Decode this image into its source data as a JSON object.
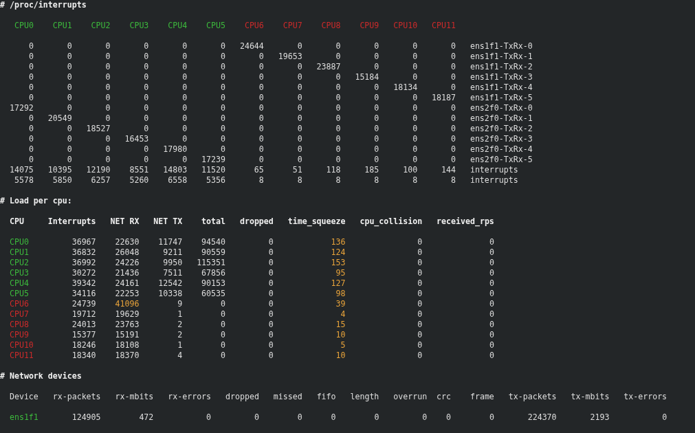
{
  "interrupts": {
    "title": "# /proc/interrupts",
    "cpus": [
      {
        "label": "CPU0",
        "color": "#3cb83c"
      },
      {
        "label": "CPU1",
        "color": "#3cb83c"
      },
      {
        "label": "CPU2",
        "color": "#3cb83c"
      },
      {
        "label": "CPU3",
        "color": "#3cb83c"
      },
      {
        "label": "CPU4",
        "color": "#3cb83c"
      },
      {
        "label": "CPU5",
        "color": "#3cb83c"
      },
      {
        "label": "CPU6",
        "color": "#cc2a2a"
      },
      {
        "label": "CPU7",
        "color": "#cc2a2a"
      },
      {
        "label": "CPU8",
        "color": "#cc2a2a"
      },
      {
        "label": "CPU9",
        "color": "#cc2a2a"
      },
      {
        "label": "CPU10",
        "color": "#cc2a2a"
      },
      {
        "label": "CPU11",
        "color": "#cc2a2a"
      }
    ],
    "rows": [
      {
        "counts": [
          "0",
          "0",
          "0",
          "0",
          "0",
          "0",
          "24644",
          "0",
          "0",
          "0",
          "0",
          "0"
        ],
        "name": "ens1f1-TxRx-0"
      },
      {
        "counts": [
          "0",
          "0",
          "0",
          "0",
          "0",
          "0",
          "0",
          "19653",
          "0",
          "0",
          "0",
          "0"
        ],
        "name": "ens1f1-TxRx-1"
      },
      {
        "counts": [
          "0",
          "0",
          "0",
          "0",
          "0",
          "0",
          "0",
          "0",
          "23887",
          "0",
          "0",
          "0"
        ],
        "name": "ens1f1-TxRx-2"
      },
      {
        "counts": [
          "0",
          "0",
          "0",
          "0",
          "0",
          "0",
          "0",
          "0",
          "0",
          "15184",
          "0",
          "0"
        ],
        "name": "ens1f1-TxRx-3"
      },
      {
        "counts": [
          "0",
          "0",
          "0",
          "0",
          "0",
          "0",
          "0",
          "0",
          "0",
          "0",
          "18134",
          "0"
        ],
        "name": "ens1f1-TxRx-4"
      },
      {
        "counts": [
          "0",
          "0",
          "0",
          "0",
          "0",
          "0",
          "0",
          "0",
          "0",
          "0",
          "0",
          "18187"
        ],
        "name": "ens1f1-TxRx-5"
      },
      {
        "counts": [
          "17292",
          "0",
          "0",
          "0",
          "0",
          "0",
          "0",
          "0",
          "0",
          "0",
          "0",
          "0"
        ],
        "name": "ens2f0-TxRx-0"
      },
      {
        "counts": [
          "0",
          "20549",
          "0",
          "0",
          "0",
          "0",
          "0",
          "0",
          "0",
          "0",
          "0",
          "0"
        ],
        "name": "ens2f0-TxRx-1"
      },
      {
        "counts": [
          "0",
          "0",
          "18527",
          "0",
          "0",
          "0",
          "0",
          "0",
          "0",
          "0",
          "0",
          "0"
        ],
        "name": "ens2f0-TxRx-2"
      },
      {
        "counts": [
          "0",
          "0",
          "0",
          "16453",
          "0",
          "0",
          "0",
          "0",
          "0",
          "0",
          "0",
          "0"
        ],
        "name": "ens2f0-TxRx-3"
      },
      {
        "counts": [
          "0",
          "0",
          "0",
          "0",
          "17980",
          "0",
          "0",
          "0",
          "0",
          "0",
          "0",
          "0"
        ],
        "name": "ens2f0-TxRx-4"
      },
      {
        "counts": [
          "0",
          "0",
          "0",
          "0",
          "0",
          "17239",
          "0",
          "0",
          "0",
          "0",
          "0",
          "0"
        ],
        "name": "ens2f0-TxRx-5"
      },
      {
        "counts": [
          "14075",
          "10395",
          "12190",
          "8551",
          "14803",
          "11520",
          "65",
          "51",
          "118",
          "185",
          "100",
          "144"
        ],
        "name": "interrupts"
      },
      {
        "counts": [
          "5578",
          "5850",
          "6257",
          "5260",
          "6558",
          "5356",
          "8",
          "8",
          "8",
          "8",
          "8",
          "8"
        ],
        "name": "interrupts"
      }
    ]
  },
  "load": {
    "title": "# Load per cpu:",
    "columns": [
      "CPU",
      "Interrupts",
      "NET RX",
      "NET TX",
      "total",
      "dropped",
      "time_squeeze",
      "cpu_collision",
      "received_rps"
    ],
    "rows": [
      {
        "cpu": "CPU0",
        "color": "#3cb83c",
        "values": [
          "36967",
          "22630",
          "11747",
          "94540",
          "0",
          {
            "text": "136",
            "color": "#e8a33a"
          },
          "0",
          "0"
        ]
      },
      {
        "cpu": "CPU1",
        "color": "#3cb83c",
        "values": [
          "36832",
          "26048",
          "9211",
          "90559",
          "0",
          {
            "text": "124",
            "color": "#e8a33a"
          },
          "0",
          "0"
        ]
      },
      {
        "cpu": "CPU2",
        "color": "#3cb83c",
        "values": [
          "36992",
          "24226",
          "9950",
          "115351",
          "0",
          {
            "text": "153",
            "color": "#e8a33a"
          },
          "0",
          "0"
        ]
      },
      {
        "cpu": "CPU3",
        "color": "#3cb83c",
        "values": [
          "30272",
          "21436",
          "7511",
          "67856",
          "0",
          {
            "text": "95",
            "color": "#e8a33a"
          },
          "0",
          "0"
        ]
      },
      {
        "cpu": "CPU4",
        "color": "#3cb83c",
        "values": [
          "39342",
          "24161",
          "12542",
          "90153",
          "0",
          {
            "text": "127",
            "color": "#e8a33a"
          },
          "0",
          "0"
        ]
      },
      {
        "cpu": "CPU5",
        "color": "#3cb83c",
        "values": [
          "34116",
          "22253",
          "10338",
          "60535",
          "0",
          {
            "text": "98",
            "color": "#e8a33a"
          },
          "0",
          "0"
        ]
      },
      {
        "cpu": "CPU6",
        "color": "#cc2a2a",
        "values": [
          "24739",
          {
            "text": "41096",
            "color": "#e8a33a"
          },
          "9",
          "0",
          "0",
          {
            "text": "39",
            "color": "#e8a33a"
          },
          "0",
          "0"
        ]
      },
      {
        "cpu": "CPU7",
        "color": "#cc2a2a",
        "values": [
          "19712",
          "19629",
          "1",
          "0",
          "0",
          {
            "text": "4",
            "color": "#e8a33a"
          },
          "0",
          "0"
        ]
      },
      {
        "cpu": "CPU8",
        "color": "#cc2a2a",
        "values": [
          "24013",
          "23763",
          "2",
          "0",
          "0",
          {
            "text": "15",
            "color": "#e8a33a"
          },
          "0",
          "0"
        ]
      },
      {
        "cpu": "CPU9",
        "color": "#cc2a2a",
        "values": [
          "15377",
          "15191",
          "2",
          "0",
          "0",
          {
            "text": "10",
            "color": "#e8a33a"
          },
          "0",
          "0"
        ]
      },
      {
        "cpu": "CPU10",
        "color": "#cc2a2a",
        "values": [
          "18246",
          "18108",
          "1",
          "0",
          "0",
          {
            "text": "5",
            "color": "#e8a33a"
          },
          "0",
          "0"
        ]
      },
      {
        "cpu": "CPU11",
        "color": "#cc2a2a",
        "values": [
          "18340",
          "18370",
          "4",
          "0",
          "0",
          {
            "text": "10",
            "color": "#e8a33a"
          },
          "0",
          "0"
        ]
      }
    ]
  },
  "network": {
    "title": "# Network devices",
    "columns": [
      "Device",
      "rx-packets",
      "rx-mbits",
      "rx-errors",
      "dropped",
      "missed",
      "fifo",
      "length",
      "overrun",
      "crc",
      "frame",
      "tx-packets",
      "tx-mbits",
      "tx-errors"
    ],
    "rows": [
      {
        "device": "ens1f1",
        "color": "#3cb83c",
        "values": [
          "124905",
          "472",
          "0",
          "0",
          "0",
          "0",
          "0",
          "0",
          "0",
          "0",
          "224370",
          "2193",
          "0"
        ]
      }
    ]
  }
}
